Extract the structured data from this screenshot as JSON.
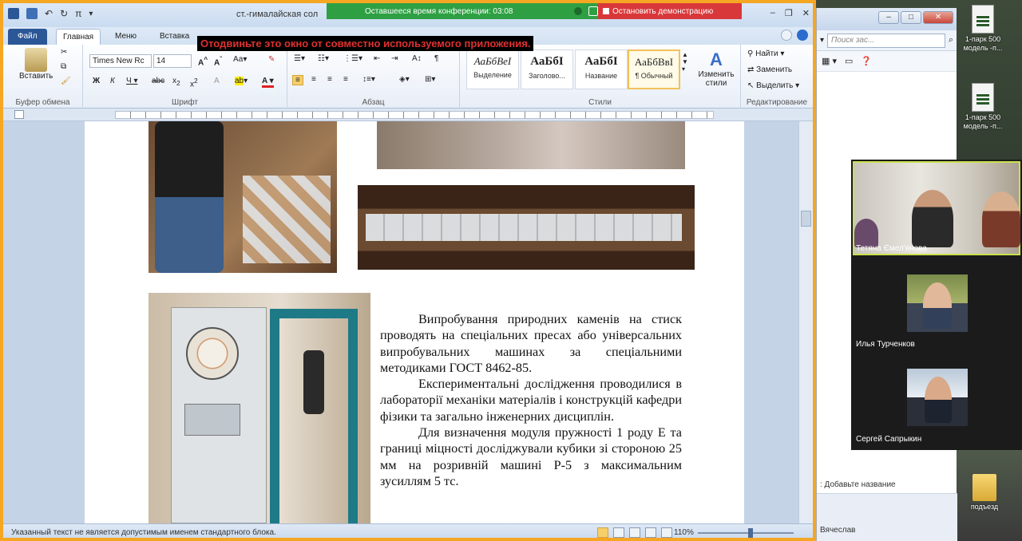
{
  "desktop": {
    "icons": [
      {
        "label": "1-парк 500 модель -п..."
      },
      {
        "label": "1-парк 500 модель -п..."
      },
      {
        "label": "подъезд"
      }
    ],
    "bottom_label": "Вячеслав"
  },
  "explorer": {
    "search_placeholder": "Поиск зас...",
    "status_text": ": Добавьте название"
  },
  "zoom": {
    "time_label": "Оставшееся время конференции: 03:08",
    "stop_label": "Остановить демонстрацию",
    "warning": "Отодвиньте это окно от совместно используемого приложения.",
    "participants": [
      {
        "name": "Тетяна Ємел'янова"
      },
      {
        "name": "Илья Турченков"
      },
      {
        "name": "Сергей Сапрыкин"
      }
    ],
    "colors": {
      "green": "#2ea043",
      "red": "#d9383a",
      "active_border": "#c9e04e"
    }
  },
  "word": {
    "title": "ст.-гималайская сол",
    "tabs": [
      "Файл",
      "Главная",
      "Меню",
      "Вставка"
    ],
    "ribbon": {
      "clipboard_label": "Буфер обмена",
      "paste_label": "Вставить",
      "font_label": "Шрифт",
      "font_name": "Times New Rc",
      "font_size": "14",
      "paragraph_label": "Абзац",
      "styles_label": "Стили",
      "styles": [
        {
          "preview": "АаБбВеI",
          "name": "Выделение"
        },
        {
          "preview": "АаБбI",
          "name": "Заголово..."
        },
        {
          "preview": "АаБбI",
          "name": "Название"
        },
        {
          "preview": "АаБбВвI",
          "name": "¶ Обычный"
        }
      ],
      "change_styles_label": "Изменить стили",
      "editing_label": "Редактирование",
      "find_label": "Найти",
      "replace_label": "Заменить",
      "select_label": "Выделить"
    },
    "document": {
      "paragraphs": [
        "Випробування природних каменів на стиск проводять на спеціальних пресах або універсальних випробувальних машинах за спеціальними методиками ГОСТ 8462-85.",
        "Експериментальні дослідження проводилися в лабораторії механіки матеріалів і конструкцій кафедри фізики та загально інженерних дисциплін.",
        "Для визначення модуля пружності 1 роду Е та границі міцності досліджували кубики зі стороною 25 мм на розривній машині Р-5 з максимальним зусиллям 5 тс."
      ]
    },
    "status": {
      "message": "Указанный текст не является допустимым именем стандартного блока.",
      "zoom": "110%",
      "zoom_fraction": 0.55
    }
  }
}
